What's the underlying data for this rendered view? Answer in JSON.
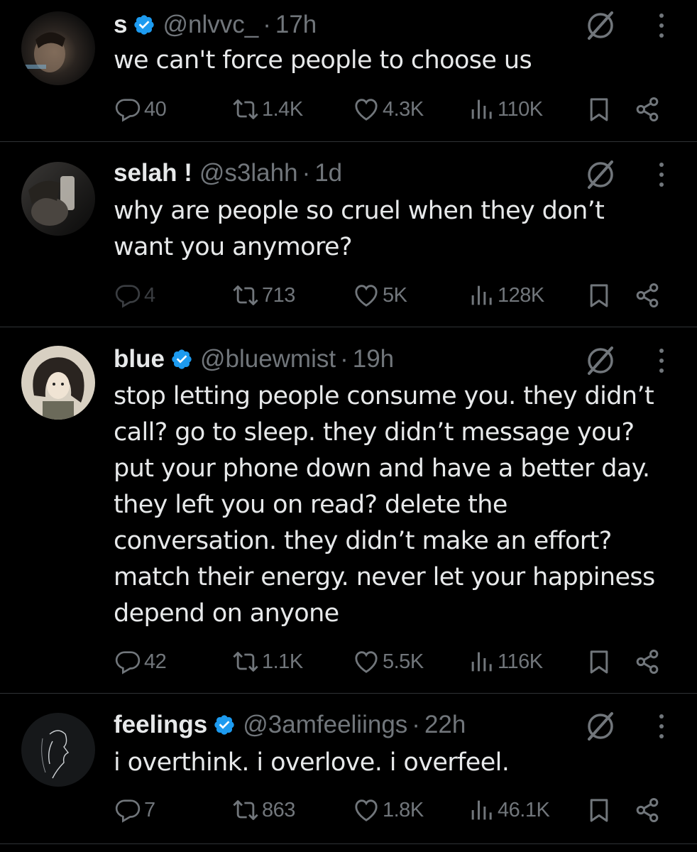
{
  "colors": {
    "background": "#000000",
    "text": "#e7e9ea",
    "secondary": "#71767b",
    "verified": "#1d9bf0",
    "divider": "#2f3336"
  },
  "icons": {
    "reply": "reply-icon",
    "repost": "repost-icon",
    "like": "like-icon",
    "views": "views-icon",
    "bookmark": "bookmark-icon",
    "share": "share-icon",
    "grok": "grok-icon",
    "more": "more-icon",
    "verified": "verified-badge-icon"
  },
  "tweets": [
    {
      "name": "s",
      "verified": true,
      "handle": "@nlvvc_",
      "separator": "·",
      "time": "17h",
      "text_lines": [
        "we can't force people to choose us"
      ],
      "replies": "40",
      "reposts": "1.4K",
      "likes": "4.3K",
      "views": "110K"
    },
    {
      "name": "selah !",
      "verified": false,
      "handle": "@s3lahh",
      "separator": "·",
      "time": "1d",
      "text_lines": [
        "why are people so cruel when they don’t",
        "want you anymore?"
      ],
      "replies": "4",
      "reposts": "713",
      "likes": "5K",
      "views": "128K"
    },
    {
      "name": "blue",
      "verified": true,
      "handle": "@bluewmist",
      "separator": "·",
      "time": "19h",
      "text_lines": [
        "stop letting people consume you. they didn’t",
        "call? go to sleep. they didn’t message you?",
        "put your phone down and have a better day.",
        "they left you on read? delete the",
        "conversation. they didn’t make an effort?",
        "match their energy. never let your happiness",
        "depend on anyone"
      ],
      "replies": "42",
      "reposts": "1.1K",
      "likes": "5.5K",
      "views": "116K"
    },
    {
      "name": "feelings",
      "verified": true,
      "handle": "@3amfeeliings",
      "separator": "·",
      "time": "22h",
      "text_lines": [
        "i overthink. i overlove. i overfeel."
      ],
      "replies": "7",
      "reposts": "863",
      "likes": "1.8K",
      "views": "46.1K"
    }
  ]
}
